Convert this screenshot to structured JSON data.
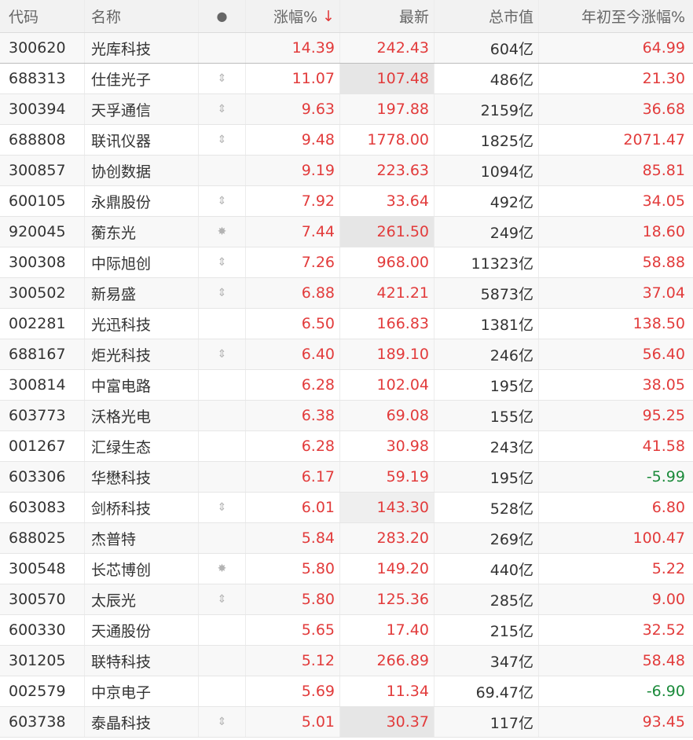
{
  "header": {
    "code": "代码",
    "name": "名称",
    "mark": "●",
    "pct": "涨幅%",
    "sort_arrow": "↓",
    "last": "最新",
    "cap": "总市值",
    "ytd": "年初至今涨幅%"
  },
  "colors": {
    "up": "#e23b3b",
    "down": "#1a8a3a"
  },
  "rows": [
    {
      "code": "300620",
      "name": "光库科技",
      "mark": "",
      "pct": "14.39",
      "last": "242.43",
      "cap": "604亿",
      "ytd": "64.99",
      "ytd_dir": "up"
    },
    {
      "code": "688313",
      "name": "仕佳光子",
      "mark": "⇕",
      "pct": "11.07",
      "last": "107.48",
      "cap": "486亿",
      "ytd": "21.30",
      "ytd_dir": "up"
    },
    {
      "code": "300394",
      "name": "天孚通信",
      "mark": "⇕",
      "pct": "9.63",
      "last": "197.88",
      "cap": "2159亿",
      "ytd": "36.68",
      "ytd_dir": "up"
    },
    {
      "code": "688808",
      "name": "联讯仪器",
      "mark": "⇕",
      "pct": "9.48",
      "last": "1778.00",
      "cap": "1825亿",
      "ytd": "2071.47",
      "ytd_dir": "up"
    },
    {
      "code": "300857",
      "name": "协创数据",
      "mark": "",
      "pct": "9.19",
      "last": "223.63",
      "cap": "1094亿",
      "ytd": "85.81",
      "ytd_dir": "up"
    },
    {
      "code": "600105",
      "name": "永鼎股份",
      "mark": "⇕",
      "pct": "7.92",
      "last": "33.64",
      "cap": "492亿",
      "ytd": "34.05",
      "ytd_dir": "up"
    },
    {
      "code": "920045",
      "name": "蘅东光",
      "mark": "✸",
      "pct": "7.44",
      "last": "261.50",
      "cap": "249亿",
      "ytd": "18.60",
      "ytd_dir": "up"
    },
    {
      "code": "300308",
      "name": "中际旭创",
      "mark": "⇕",
      "pct": "7.26",
      "last": "968.00",
      "cap": "11323亿",
      "ytd": "58.88",
      "ytd_dir": "up"
    },
    {
      "code": "300502",
      "name": "新易盛",
      "mark": "⇕",
      "pct": "6.88",
      "last": "421.21",
      "cap": "5873亿",
      "ytd": "37.04",
      "ytd_dir": "up"
    },
    {
      "code": "002281",
      "name": "光迅科技",
      "mark": "",
      "pct": "6.50",
      "last": "166.83",
      "cap": "1381亿",
      "ytd": "138.50",
      "ytd_dir": "up"
    },
    {
      "code": "688167",
      "name": "炬光科技",
      "mark": "⇕",
      "pct": "6.40",
      "last": "189.10",
      "cap": "246亿",
      "ytd": "56.40",
      "ytd_dir": "up"
    },
    {
      "code": "300814",
      "name": "中富电路",
      "mark": "",
      "pct": "6.28",
      "last": "102.04",
      "cap": "195亿",
      "ytd": "38.05",
      "ytd_dir": "up"
    },
    {
      "code": "603773",
      "name": "沃格光电",
      "mark": "",
      "pct": "6.38",
      "last": "69.08",
      "cap": "155亿",
      "ytd": "95.25",
      "ytd_dir": "up"
    },
    {
      "code": "001267",
      "name": "汇绿生态",
      "mark": "",
      "pct": "6.28",
      "last": "30.98",
      "cap": "243亿",
      "ytd": "41.58",
      "ytd_dir": "up"
    },
    {
      "code": "603306",
      "name": "华懋科技",
      "mark": "",
      "pct": "6.17",
      "last": "59.19",
      "cap": "195亿",
      "ytd": "-5.99",
      "ytd_dir": "down"
    },
    {
      "code": "603083",
      "name": "剑桥科技",
      "mark": "⇕",
      "pct": "6.01",
      "last": "143.30",
      "cap": "528亿",
      "ytd": "6.80",
      "ytd_dir": "up"
    },
    {
      "code": "688025",
      "name": "杰普特",
      "mark": "",
      "pct": "5.84",
      "last": "283.20",
      "cap": "269亿",
      "ytd": "100.47",
      "ytd_dir": "up"
    },
    {
      "code": "300548",
      "name": "长芯博创",
      "mark": "✸",
      "pct": "5.80",
      "last": "149.20",
      "cap": "440亿",
      "ytd": "5.22",
      "ytd_dir": "up"
    },
    {
      "code": "300570",
      "name": "太辰光",
      "mark": "⇕",
      "pct": "5.80",
      "last": "125.36",
      "cap": "285亿",
      "ytd": "9.00",
      "ytd_dir": "up"
    },
    {
      "code": "600330",
      "name": "天通股份",
      "mark": "",
      "pct": "5.65",
      "last": "17.40",
      "cap": "215亿",
      "ytd": "32.52",
      "ytd_dir": "up"
    },
    {
      "code": "301205",
      "name": "联特科技",
      "mark": "",
      "pct": "5.12",
      "last": "266.89",
      "cap": "347亿",
      "ytd": "58.48",
      "ytd_dir": "up"
    },
    {
      "code": "002579",
      "name": "中京电子",
      "mark": "",
      "pct": "5.69",
      "last": "11.34",
      "cap": "69.47亿",
      "ytd": "-6.90",
      "ytd_dir": "down"
    },
    {
      "code": "603738",
      "name": "泰晶科技",
      "mark": "⇕",
      "pct": "5.01",
      "last": "30.37",
      "cap": "117亿",
      "ytd": "93.45",
      "ytd_dir": "up"
    }
  ]
}
